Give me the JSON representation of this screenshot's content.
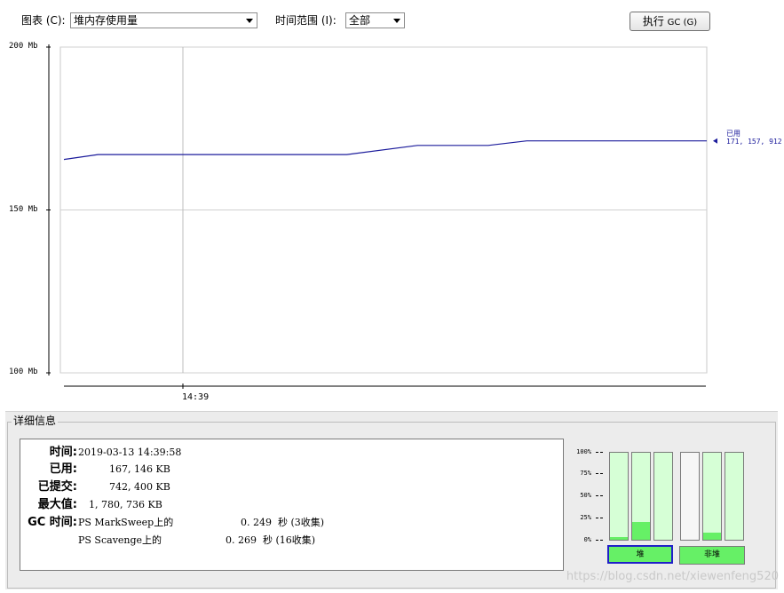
{
  "toolbar": {
    "chart_label": "图表 (C):",
    "chart_value": "堆内存使用量",
    "range_label": "时间范围 (I):",
    "range_value": "全部",
    "gc_button_prefix": "执行 ",
    "gc_button_gc": "GC",
    "gc_button_suffix": " (G)"
  },
  "chart_data": {
    "type": "line",
    "ylabel_ticks": [
      "100 Mb",
      "150 Mb",
      "200 Mb"
    ],
    "ylim": [
      100,
      200
    ],
    "xtick_label": "14:39",
    "series": [
      {
        "name": "已用",
        "x": [
          0,
          0.053,
          0.44,
          0.55,
          0.66,
          0.72,
          1.0
        ],
        "values": [
          165.5,
          167.0,
          167.0,
          169.8,
          169.8,
          171.2,
          171.2
        ]
      }
    ],
    "last_value_label": "已用",
    "last_value": "171, 157, 912",
    "colors": {
      "line": "#1c1c9c",
      "grid": "#d0d0d0",
      "axis": "#000000"
    }
  },
  "details": {
    "title": "详细信息",
    "time_label": "时间:",
    "time_value": "2019-03-13 14:39:58",
    "used_label": "已用:",
    "used_value": "167, 146 KB",
    "committed_label": "已提交:",
    "committed_value": "742, 400 KB",
    "max_label": "最大值:",
    "max_value": "1, 780, 736 KB",
    "gc_label": "GC 时间:",
    "gc_rows": [
      {
        "name": "PS MarkSweep上的",
        "time": "0. 249  秒 (3收集)"
      },
      {
        "name": "PS Scavenge上的",
        "time": "0. 269  秒 (16收集)"
      }
    ]
  },
  "pool_chart": {
    "pct_labels": [
      "100%",
      "75%",
      "50%",
      "25%",
      "0%"
    ],
    "heap_bars": [
      0.03,
      0.2,
      0.0
    ],
    "nonheap_bars": [
      null,
      0.08,
      0.0
    ],
    "heap_label": "堆",
    "nonheap_label": "非堆",
    "fill_color": "#66f066",
    "bg_color": "#d6ffd6"
  },
  "watermark": "https://blog.csdn.net/xiewenfeng520"
}
